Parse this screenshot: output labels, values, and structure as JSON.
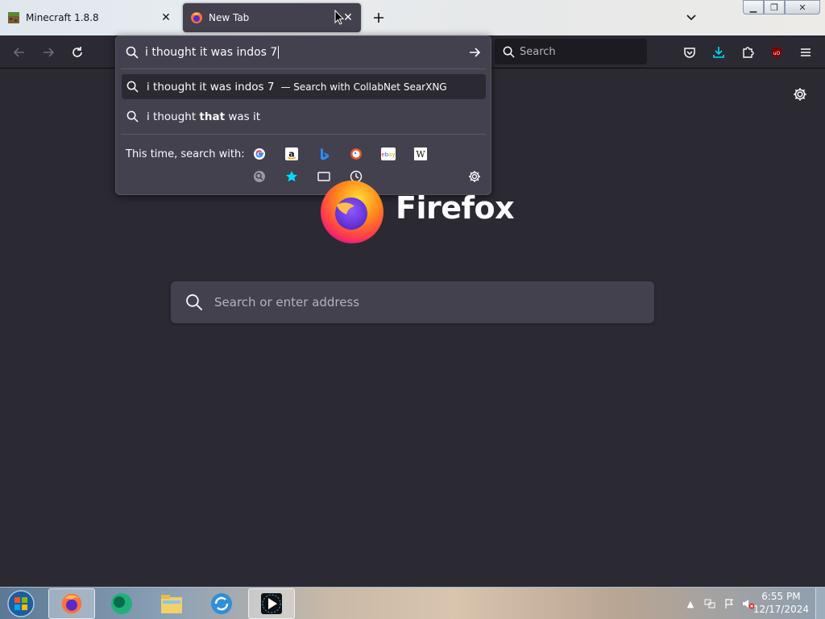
{
  "tabs": [
    {
      "title": "Minecraft 1.8.8",
      "favicon": "minecraft-block-icon",
      "active": false
    },
    {
      "title": "New Tab",
      "favicon": "firefox-icon",
      "active": true
    }
  ],
  "toolbar": {
    "search_placeholder": "Search"
  },
  "urlbar": {
    "typed_text": "i thought it was indos 7",
    "results": [
      {
        "text": "i thought it was indos 7",
        "action": "— Search with CollabNet SearXNG",
        "selected": true
      },
      {
        "text_before": "i thought ",
        "text_bold": "that",
        "text_after": " was it",
        "selected": false
      }
    ],
    "one_offs_label": "This time, search with:",
    "engines": [
      "google-icon",
      "amazon-icon",
      "bing-icon",
      "duckduckgo-icon",
      "ebay-icon",
      "wikipedia-icon",
      "searxng-icon",
      "bookmarks-star-icon",
      "tabs-icon",
      "history-icon"
    ]
  },
  "ntp": {
    "brand": "Firefox",
    "search_placeholder": "Search or enter address"
  },
  "taskbar": {
    "apps": [
      "firefox-icon",
      "app-green-icon",
      "file-explorer-icon",
      "sync-icon",
      "media-player-icon"
    ],
    "time": "6:55 PM",
    "date": "12/17/2024"
  },
  "colors": {
    "page_bg": "#2b2a33",
    "popup_bg": "#42414d",
    "accent": "#00ddff"
  }
}
